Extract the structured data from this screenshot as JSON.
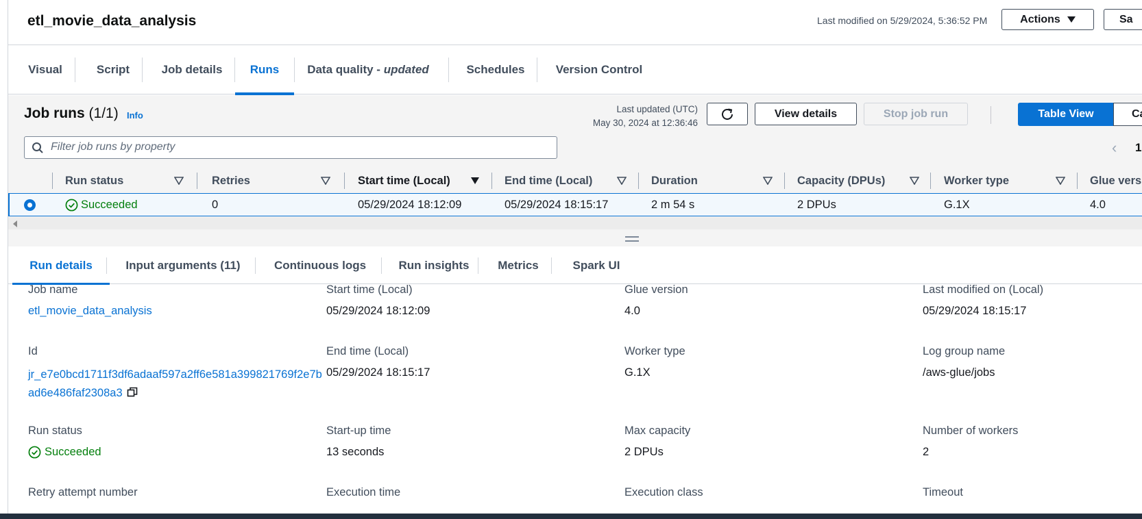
{
  "header": {
    "job_name": "etl_movie_data_analysis",
    "last_modified": "Last modified on 5/29/2024, 5:36:52 PM",
    "actions_label": "Actions",
    "save_label": "Sa"
  },
  "tabs": [
    {
      "label": "Visual"
    },
    {
      "label": "Script"
    },
    {
      "label": "Job details"
    },
    {
      "label": "Runs",
      "active": true
    },
    {
      "label": "Data quality - ",
      "suffix": "updated"
    },
    {
      "label": "Schedules"
    },
    {
      "label": "Version Control"
    }
  ],
  "runs": {
    "title": "Job runs",
    "count": "(1/1)",
    "info": "Info",
    "last_updated_label": "Last updated (UTC)",
    "last_updated_value": "May 30, 2024 at 12:36:46",
    "view_details": "View details",
    "stop_job_run": "Stop job run",
    "table_view": "Table View",
    "card_view": "Ca",
    "filter_placeholder": "Filter job runs by property",
    "page": "1"
  },
  "table": {
    "columns": [
      "Run status",
      "Retries",
      "Start time (Local)",
      "End time (Local)",
      "Duration",
      "Capacity (DPUs)",
      "Worker type",
      "Glue versi"
    ],
    "row": {
      "status": "Succeeded",
      "retries": "0",
      "start": "05/29/2024 18:12:09",
      "end": "05/29/2024 18:15:17",
      "duration": "2 m 54 s",
      "capacity": "2 DPUs",
      "worker": "G.1X",
      "glue": "4.0"
    }
  },
  "detail_tabs": [
    {
      "label": "Run details",
      "active": true
    },
    {
      "label": "Input arguments (11)"
    },
    {
      "label": "Continuous logs"
    },
    {
      "label": "Run insights"
    },
    {
      "label": "Metrics"
    },
    {
      "label": "Spark UI"
    }
  ],
  "details": {
    "job_name_label": "Job name",
    "job_name_value": "etl_movie_data_analysis",
    "start_label": "Start time (Local)",
    "start_value": "05/29/2024 18:12:09",
    "glue_label": "Glue version",
    "glue_value": "4.0",
    "lastmod_label": "Last modified on (Local)",
    "lastmod_value": "05/29/2024 18:15:17",
    "id_label": "Id",
    "id_value": "jr_e7e0bcd1711f3df6adaaf597a2ff6e581a399821769f2e7bad6e486faf2308a3",
    "end_label": "End time (Local)",
    "end_value": "05/29/2024 18:15:17",
    "worker_label": "Worker type",
    "worker_value": "G.1X",
    "loggroup_label": "Log group name",
    "loggroup_value": "/aws-glue/jobs",
    "status_label": "Run status",
    "status_value": "Succeeded",
    "startup_label": "Start-up time",
    "startup_value": "13 seconds",
    "maxcap_label": "Max capacity",
    "maxcap_value": "2 DPUs",
    "workers_label": "Number of workers",
    "workers_value": "2",
    "retry_label": "Retry attempt number",
    "exec_time_label": "Execution time",
    "exec_class_label": "Execution class",
    "timeout_label": "Timeout"
  },
  "colors": {
    "accent": "#0972d3",
    "success": "#037f0c",
    "text": "#16191f",
    "muted": "#414d5c"
  },
  "icons": [
    "refresh-icon",
    "search-icon",
    "sort-icon",
    "sort-desc-icon",
    "check-circle-icon",
    "copy-icon",
    "chevron-left-icon",
    "caret-down-icon"
  ]
}
